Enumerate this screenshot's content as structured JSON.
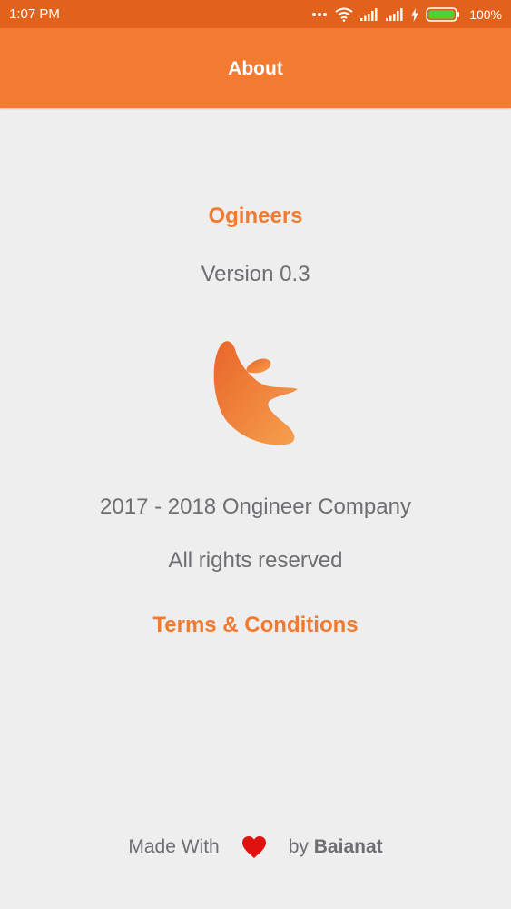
{
  "status_bar": {
    "time": "1:07 PM",
    "battery_percent": "100%",
    "icons": [
      "more-dots-icon",
      "wifi-icon",
      "signal-icon",
      "signal-icon",
      "charging-icon",
      "battery-icon"
    ]
  },
  "app_bar": {
    "title": "About"
  },
  "main": {
    "company_name": "Ogineers",
    "version": "Version 0.3",
    "logo_icon": "ogineers-logo",
    "copyright": "2017 - 2018 Ongineer Company",
    "rights": "All rights reserved",
    "terms_link": "Terms & Conditions"
  },
  "footer": {
    "made_with": "Made With",
    "heart_icon": "heart-icon",
    "by": "by",
    "brand": "Baianat"
  },
  "colors": {
    "status_bar": "#e2621b",
    "app_bar": "#f27a31",
    "accent": "#f07b30",
    "text": "#6d6d72",
    "background": "#efeeef",
    "heart": "#e0120f",
    "battery": "#4cd137"
  }
}
